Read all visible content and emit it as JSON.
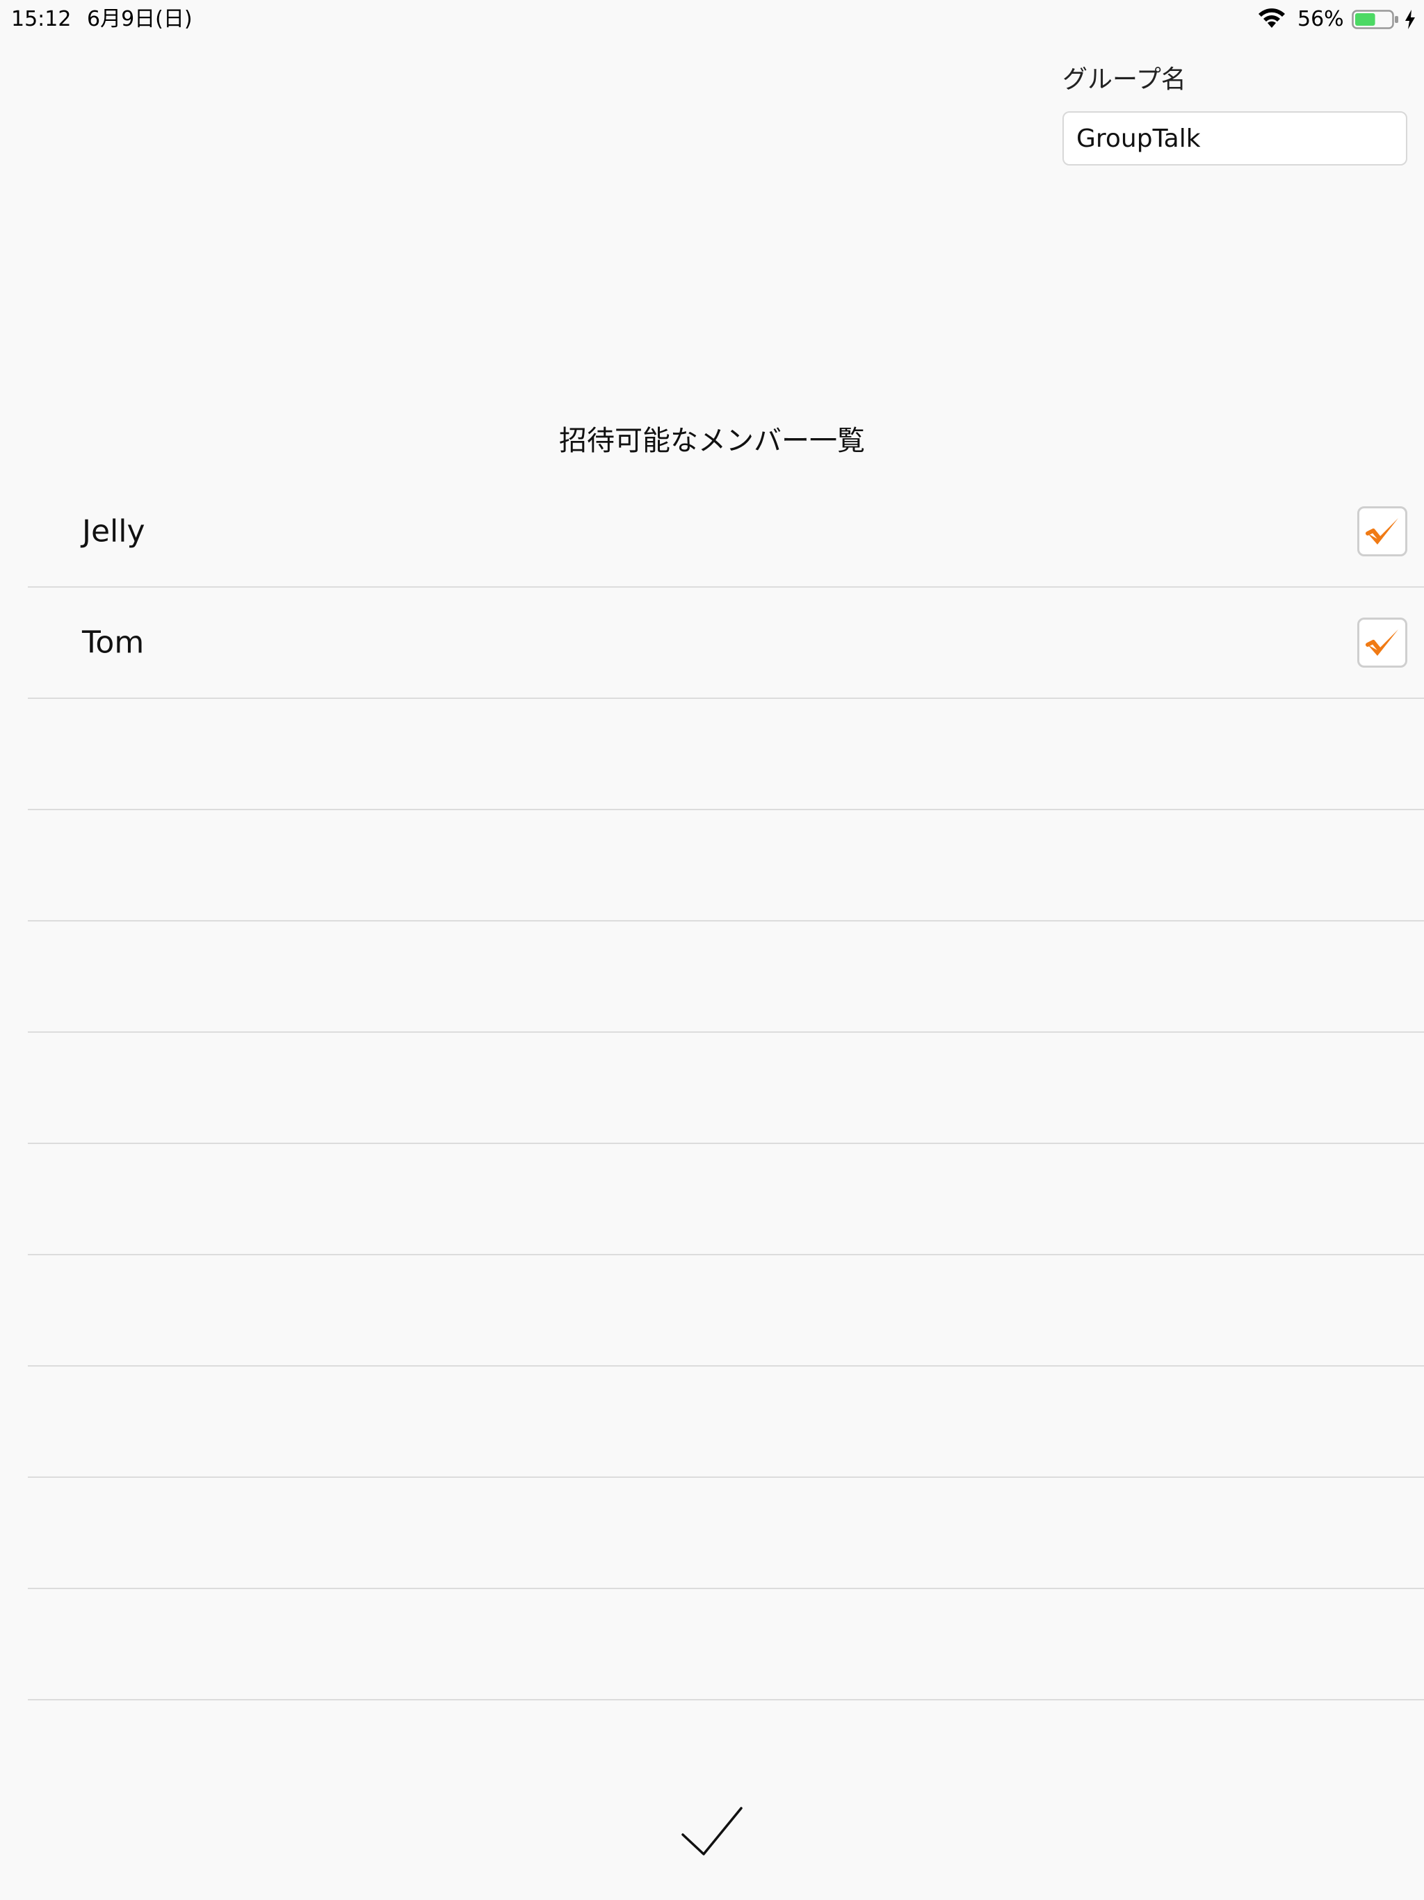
{
  "status_bar": {
    "time": "15:12",
    "date": "6月9日(日)",
    "battery_percent": "56%",
    "battery_level": 0.56,
    "battery_color": "#4cd964",
    "icons": [
      "wifi-icon",
      "battery-icon",
      "charging-icon"
    ]
  },
  "group": {
    "label": "グループ名",
    "name_value": "GroupTalk"
  },
  "member_list": {
    "title": "招待可能なメンバー一覧",
    "members": [
      {
        "name": "Jelly",
        "checked": true
      },
      {
        "name": "Tom",
        "checked": true
      }
    ],
    "empty_rows": 9
  },
  "colors": {
    "check_accent": "#f07a14",
    "background": "#f9f9f9",
    "separator": "#dcdcdc"
  },
  "actions": {
    "done_icon": "checkmark-icon"
  }
}
